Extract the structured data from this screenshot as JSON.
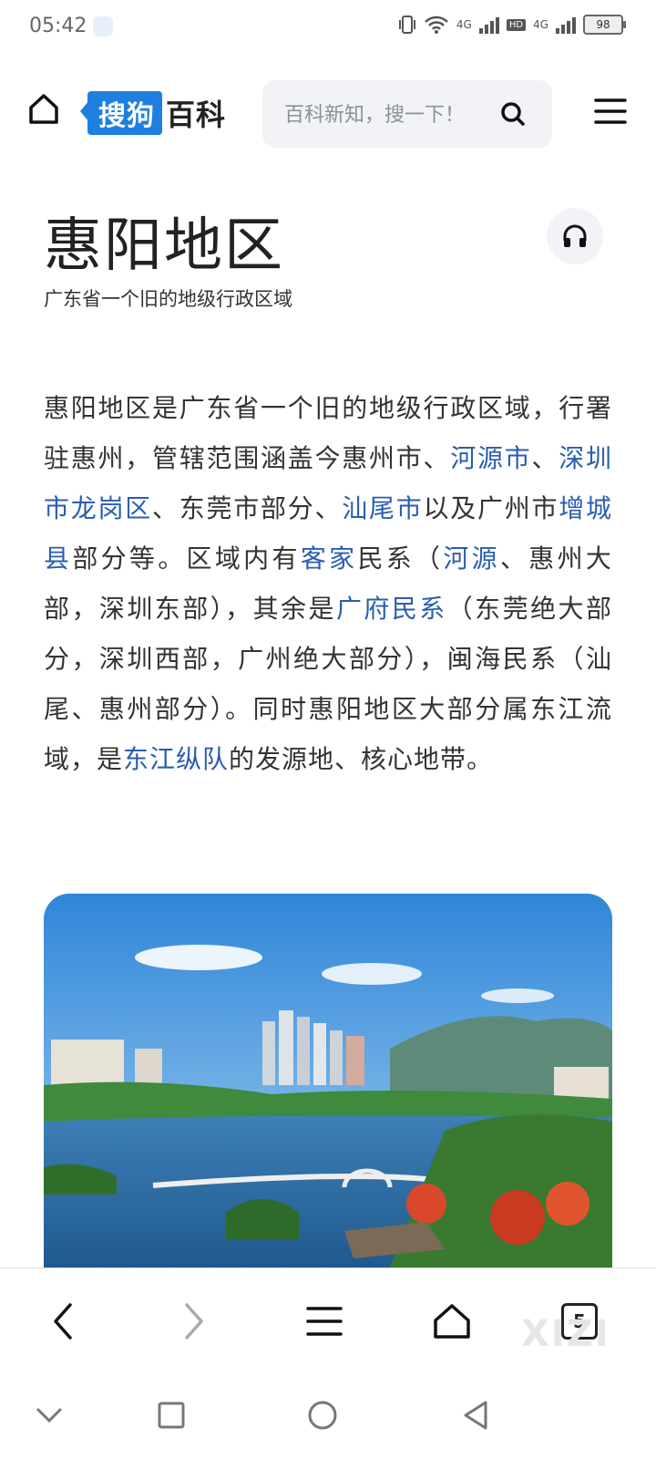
{
  "status": {
    "time": "05:42",
    "network_a": "4G",
    "hd": "HD",
    "network_b": "4G",
    "battery": "98"
  },
  "header": {
    "logo_brand": "搜狗",
    "logo_product": "百科",
    "search_placeholder": "百科新知，搜一下！"
  },
  "article": {
    "title": "惠阳地区",
    "subtitle": "广东省一个旧的地级行政区域",
    "paragraph": [
      {
        "text": "惠阳地区是广东省一个旧的地级行政区域，行署驻惠州，管辖范围涵盖今惠州市、",
        "link": false
      },
      {
        "text": "河源市",
        "link": true
      },
      {
        "text": "、",
        "link": false
      },
      {
        "text": "深圳市龙岗区",
        "link": true
      },
      {
        "text": "、东莞市部分、",
        "link": false
      },
      {
        "text": "汕尾市",
        "link": true
      },
      {
        "text": "以及广州市",
        "link": false
      },
      {
        "text": "增城县",
        "link": true
      },
      {
        "text": "部分等。区域内有",
        "link": false
      },
      {
        "text": "客家",
        "link": true
      },
      {
        "text": "民系（",
        "link": false
      },
      {
        "text": "河源",
        "link": true
      },
      {
        "text": "、惠州大部，深圳东部），其余是",
        "link": false
      },
      {
        "text": "广府民系",
        "link": true
      },
      {
        "text": "（东莞绝大部分，深圳西部，广州绝大部分），闽海民系（汕尾、惠州部分）。同时惠阳地区大部分属东江流域，是",
        "link": false
      },
      {
        "text": "东江纵队",
        "link": true
      },
      {
        "text": "的发源地、核心地带。",
        "link": false
      }
    ]
  },
  "bottom_nav": {
    "tab_count": "5",
    "watermark": "XIZI"
  },
  "colors": {
    "link": "#2a5db0",
    "brand": "#1e7fe0"
  }
}
